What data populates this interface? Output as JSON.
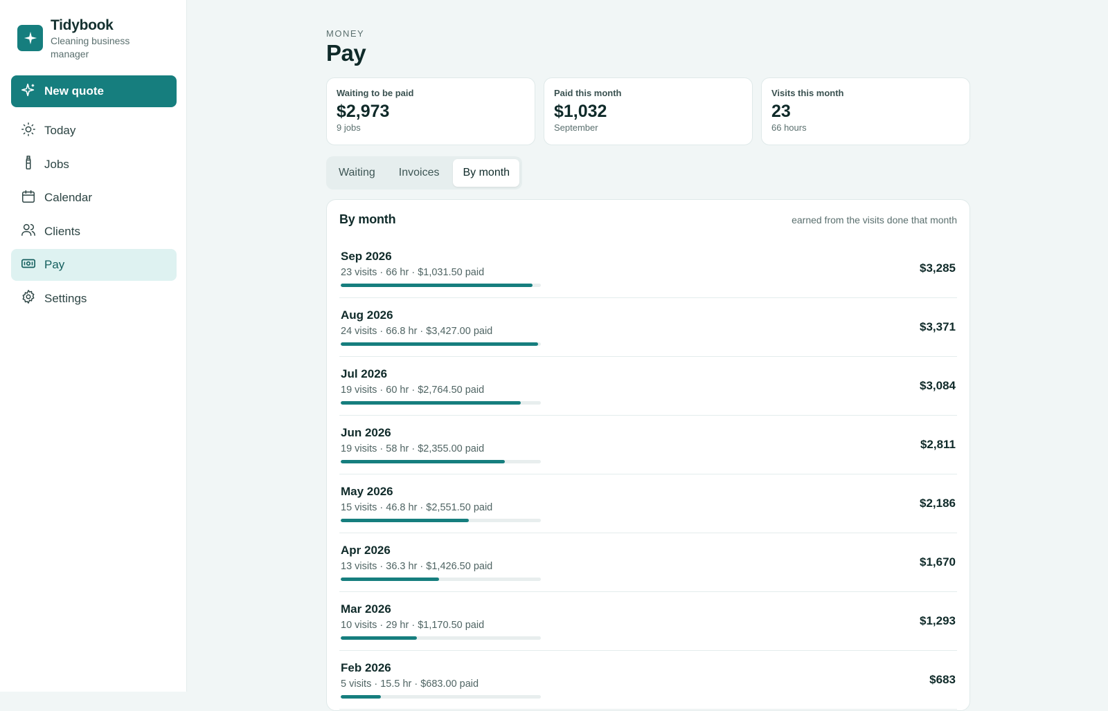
{
  "brand": {
    "name": "Tidybook",
    "subtitle": "Cleaning business manager"
  },
  "sidebar": {
    "new_quote": "New quote",
    "items": [
      {
        "label": "Today",
        "icon": "sun-icon"
      },
      {
        "label": "Jobs",
        "icon": "spray-bottle-icon"
      },
      {
        "label": "Calendar",
        "icon": "calendar-icon"
      },
      {
        "label": "Clients",
        "icon": "users-icon"
      },
      {
        "label": "Pay",
        "icon": "banknote-icon",
        "active": true
      },
      {
        "label": "Settings",
        "icon": "gear-icon"
      }
    ]
  },
  "header": {
    "eyebrow": "MONEY",
    "title": "Pay"
  },
  "stats": [
    {
      "label": "Waiting to be paid",
      "value": "$2,973",
      "sub": "9 jobs"
    },
    {
      "label": "Paid this month",
      "value": "$1,032",
      "sub": "September"
    },
    {
      "label": "Visits this month",
      "value": "23",
      "sub": "66 hours"
    }
  ],
  "tabs": [
    {
      "label": "Waiting"
    },
    {
      "label": "Invoices"
    },
    {
      "label": "By month",
      "active": true
    }
  ],
  "panel": {
    "title": "By month",
    "note": "earned from the visits done that month",
    "rows": [
      {
        "month": "Sep 2026",
        "detail": "23 visits · 66 hr · $1,031.50 paid",
        "amount": "$3,285",
        "bar_fraction": 0.96
      },
      {
        "month": "Aug 2026",
        "detail": "24 visits · 66.8 hr · $3,427.00 paid",
        "amount": "$3,371",
        "bar_fraction": 0.985
      },
      {
        "month": "Jul 2026",
        "detail": "19 visits · 60 hr · $2,764.50 paid",
        "amount": "$3,084",
        "bar_fraction": 0.9
      },
      {
        "month": "Jun 2026",
        "detail": "19 visits · 58 hr · $2,355.00 paid",
        "amount": "$2,811",
        "bar_fraction": 0.82
      },
      {
        "month": "May 2026",
        "detail": "15 visits · 46.8 hr · $2,551.50 paid",
        "amount": "$2,186",
        "bar_fraction": 0.64
      },
      {
        "month": "Apr 2026",
        "detail": "13 visits · 36.3 hr · $1,426.50 paid",
        "amount": "$1,670",
        "bar_fraction": 0.49
      },
      {
        "month": "Mar 2026",
        "detail": "10 visits · 29 hr · $1,170.50 paid",
        "amount": "$1,293",
        "bar_fraction": 0.38
      },
      {
        "month": "Feb 2026",
        "detail": "5 visits · 15.5 hr · $683.00 paid",
        "amount": "$683",
        "bar_fraction": 0.2
      }
    ]
  },
  "colors": {
    "accent": "#167e7e",
    "active_bg": "#def2f1",
    "page_bg": "#f1f6f6"
  }
}
